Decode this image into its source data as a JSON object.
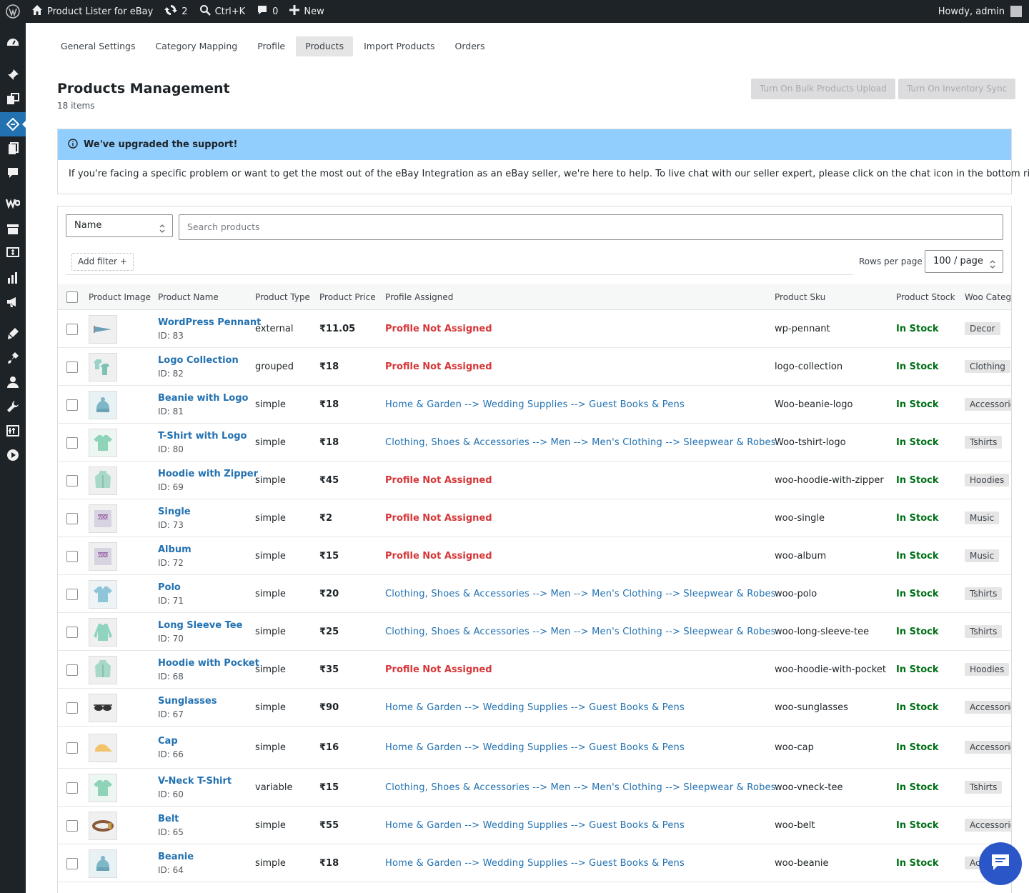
{
  "adminbar": {
    "site_name": "Product Lister for eBay",
    "updates_count": "2",
    "search_shortcut": "Ctrl+K",
    "comments_count": "0",
    "new_label": "New",
    "greeting": "Howdy, admin"
  },
  "tabs": [
    "General Settings",
    "Category Mapping",
    "Profile",
    "Products",
    "Import Products",
    "Orders"
  ],
  "active_tab": "Products",
  "page": {
    "title": "Products Management",
    "count": "18 items",
    "bulk_upload_label": "Turn On Bulk Products Upload",
    "inventory_sync_label": "Turn On Inventory Sync"
  },
  "notice": {
    "title": "We've upgraded the support!",
    "body": "If you're facing a specific problem or want to get the most out of the eBay Integration as an eBay seller, we're here to help. To live chat with our seller expert, please click on the chat icon in the bottom right."
  },
  "filters": {
    "field_select": "Name",
    "search_placeholder": "Search products",
    "add_filter": "Add filter +",
    "rows_per_page_label": "Rows per page",
    "rows_per_page": "100 / page"
  },
  "columns": [
    "Product Image",
    "Product Name",
    "Product Type",
    "Product Price",
    "Profile Assigned",
    "Product Sku",
    "Product Stock",
    "Woo Catego"
  ],
  "colors": {
    "accent": "#2271b1",
    "not_assigned": "#d63638",
    "in_stock": "#007017",
    "notice_bg": "#91cdfd",
    "chat_bg": "#2b56c7"
  },
  "products": [
    {
      "name": "WordPress Pennant",
      "id": "ID: 83",
      "type": "external",
      "price": "₹11.05",
      "profile": "Profile Not Assigned",
      "assigned": false,
      "sku": "wp-pennant",
      "stock": "In Stock",
      "category": "Decor",
      "icon": "pennant-icon"
    },
    {
      "name": "Logo Collection",
      "id": "ID: 82",
      "type": "grouped",
      "price": "₹18",
      "profile": "Profile Not Assigned",
      "assigned": false,
      "sku": "logo-collection",
      "stock": "In Stock",
      "category": "Clothing",
      "icon": "clothing-collection-icon"
    },
    {
      "name": "Beanie with Logo",
      "id": "ID: 81",
      "type": "simple",
      "price": "₹18",
      "profile": "Home & Garden --> Wedding Supplies --> Guest Books & Pens",
      "assigned": true,
      "sku": "Woo-beanie-logo",
      "stock": "In Stock",
      "category": "Accessories",
      "icon": "beanie-icon"
    },
    {
      "name": "T-Shirt with Logo",
      "id": "ID: 80",
      "type": "simple",
      "price": "₹18",
      "profile": "Clothing, Shoes & Accessories --> Men --> Men's Clothing --> Sleepwear & Robes",
      "assigned": true,
      "sku": "Woo-tshirt-logo",
      "stock": "In Stock",
      "category": "Tshirts",
      "icon": "tshirt-icon"
    },
    {
      "name": "Hoodie with Zipper",
      "id": "ID: 69",
      "type": "simple",
      "price": "₹45",
      "profile": "Profile Not Assigned",
      "assigned": false,
      "sku": "woo-hoodie-with-zipper",
      "stock": "In Stock",
      "category": "Hoodies",
      "icon": "hoodie-icon"
    },
    {
      "name": "Single",
      "id": "ID: 73",
      "type": "simple",
      "price": "₹2",
      "profile": "Profile Not Assigned",
      "assigned": false,
      "sku": "woo-single",
      "stock": "In Stock",
      "category": "Music",
      "icon": "album-icon"
    },
    {
      "name": "Album",
      "id": "ID: 72",
      "type": "simple",
      "price": "₹15",
      "profile": "Profile Not Assigned",
      "assigned": false,
      "sku": "woo-album",
      "stock": "In Stock",
      "category": "Music",
      "icon": "album-icon"
    },
    {
      "name": "Polo",
      "id": "ID: 71",
      "type": "simple",
      "price": "₹20",
      "profile": "Clothing, Shoes & Accessories --> Men --> Men's Clothing --> Sleepwear & Robes",
      "assigned": true,
      "sku": "woo-polo",
      "stock": "In Stock",
      "category": "Tshirts",
      "icon": "polo-icon"
    },
    {
      "name": "Long Sleeve Tee",
      "id": "ID: 70",
      "type": "simple",
      "price": "₹25",
      "profile": "Clothing, Shoes & Accessories --> Men --> Men's Clothing --> Sleepwear & Robes",
      "assigned": true,
      "sku": "woo-long-sleeve-tee",
      "stock": "In Stock",
      "category": "Tshirts",
      "icon": "long-sleeve-tee-icon"
    },
    {
      "name": "Hoodie with Pocket",
      "id": "ID: 68",
      "type": "simple",
      "price": "₹35",
      "profile": "Profile Not Assigned",
      "assigned": false,
      "sku": "woo-hoodie-with-pocket",
      "stock": "In Stock",
      "category": "Hoodies",
      "icon": "hoodie-icon"
    },
    {
      "name": "Sunglasses",
      "id": "ID: 67",
      "type": "simple",
      "price": "₹90",
      "profile": "Home & Garden --> Wedding Supplies --> Guest Books & Pens",
      "assigned": true,
      "sku": "woo-sunglasses",
      "stock": "In Stock",
      "category": "Accessories",
      "icon": "sunglasses-icon"
    },
    {
      "name": "Cap",
      "id": "ID: 66",
      "type": "simple",
      "price": "₹16",
      "profile": "Home & Garden --> Wedding Supplies --> Guest Books & Pens",
      "assigned": true,
      "sku": "woo-cap",
      "stock": "In Stock",
      "category": "Accessories",
      "icon": "cap-icon"
    },
    {
      "name": "V-Neck T-Shirt",
      "id": "ID: 60",
      "type": "variable",
      "price": "₹15",
      "profile": "Clothing, Shoes & Accessories --> Men --> Men's Clothing --> Sleepwear & Robes",
      "assigned": true,
      "sku": "woo-vneck-tee",
      "stock": "In Stock",
      "category": "Tshirts",
      "icon": "tshirt-icon"
    },
    {
      "name": "Belt",
      "id": "ID: 65",
      "type": "simple",
      "price": "₹55",
      "profile": "Home & Garden --> Wedding Supplies --> Guest Books & Pens",
      "assigned": true,
      "sku": "woo-belt",
      "stock": "In Stock",
      "category": "Accessories",
      "icon": "belt-icon"
    },
    {
      "name": "Beanie",
      "id": "ID: 64",
      "type": "simple",
      "price": "₹18",
      "profile": "Home & Garden --> Wedding Supplies --> Guest Books & Pens",
      "assigned": true,
      "sku": "woo-beanie",
      "stock": "In Stock",
      "category": "Accessories",
      "icon": "beanie-icon"
    }
  ],
  "sidebar_icons": [
    "dashboard-icon",
    "pin-icon",
    "media-icon",
    "ebay-plugin-icon",
    "pages-icon",
    "comments-icon",
    "woocommerce-icon",
    "products-icon",
    "payments-icon",
    "analytics-icon",
    "marketing-icon",
    "appearance-icon",
    "plugins-icon",
    "users-icon",
    "tools-icon",
    "settings-icon",
    "play-icon"
  ]
}
